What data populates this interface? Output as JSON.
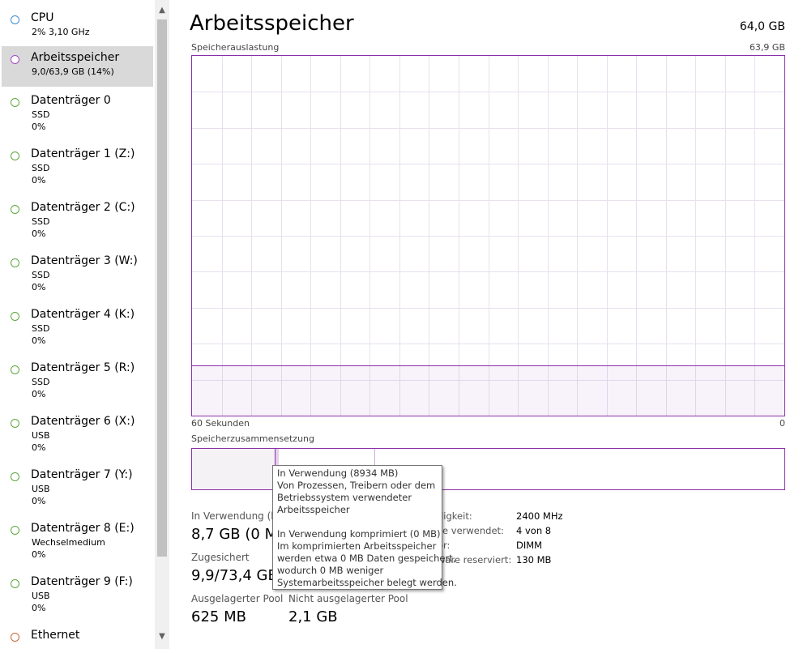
{
  "sidebar": {
    "items": [
      {
        "title": "CPU",
        "sub1": "2% 3,10 GHz",
        "sub2": "",
        "color": "#3c8fd7",
        "selected": false
      },
      {
        "title": "Arbeitsspeicher",
        "sub1": "9,0/63,9 GB (14%)",
        "sub2": "",
        "color": "#a64ac9",
        "selected": true
      },
      {
        "title": "Datenträger 0",
        "sub1": "SSD",
        "sub2": "0%",
        "color": "#5aa83c",
        "selected": false
      },
      {
        "title": "Datenträger 1 (Z:)",
        "sub1": "SSD",
        "sub2": "0%",
        "color": "#5aa83c",
        "selected": false
      },
      {
        "title": "Datenträger 2 (C:)",
        "sub1": "SSD",
        "sub2": "0%",
        "color": "#5aa83c",
        "selected": false
      },
      {
        "title": "Datenträger 3 (W:)",
        "sub1": "SSD",
        "sub2": "0%",
        "color": "#5aa83c",
        "selected": false
      },
      {
        "title": "Datenträger 4 (K:)",
        "sub1": "SSD",
        "sub2": "0%",
        "color": "#5aa83c",
        "selected": false
      },
      {
        "title": "Datenträger 5 (R:)",
        "sub1": "SSD",
        "sub2": "0%",
        "color": "#5aa83c",
        "selected": false
      },
      {
        "title": "Datenträger 6 (X:)",
        "sub1": "USB",
        "sub2": "0%",
        "color": "#5aa83c",
        "selected": false
      },
      {
        "title": "Datenträger 7 (Y:)",
        "sub1": "USB",
        "sub2": "0%",
        "color": "#5aa83c",
        "selected": false
      },
      {
        "title": "Datenträger 8 (E:)",
        "sub1": "Wechselmedium",
        "sub2": "0%",
        "color": "#5aa83c",
        "selected": false
      },
      {
        "title": "Datenträger 9 (F:)",
        "sub1": "USB",
        "sub2": "0%",
        "color": "#5aa83c",
        "selected": false
      },
      {
        "title": "Ethernet",
        "sub1": "",
        "sub2": "",
        "color": "#c56a35",
        "selected": false
      }
    ],
    "scroll_up_icon": "chevron-up-icon",
    "scroll_down_icon": "chevron-down-icon"
  },
  "main": {
    "title": "Arbeitsspeicher",
    "total": "64,0 GB",
    "usage_graph": {
      "label": "Speicherauslastung",
      "max_label": "63,9 GB",
      "x_left_label": "60 Sekunden",
      "x_right_label": "0",
      "used_fraction": 0.14
    },
    "composition": {
      "label": "Speicherzusammensetzung"
    },
    "stats": {
      "in_use_label": "In Verwendung (ko",
      "in_use_value": "8,7 GB (0 M",
      "committed_label": "Zugesichert",
      "committed_value": "9,9/73,4 GB",
      "paged_label": "Ausgelagerter Pool",
      "paged_value": "625 MB",
      "nonpaged_label": "Nicht ausgelagerter Pool",
      "nonpaged_value": "2,1 GB"
    },
    "details": [
      {
        "label": "digkeit:",
        "value": "2400 MHz"
      },
      {
        "label": "ze verwendet:",
        "value": "4 von 8"
      },
      {
        "label": "or:",
        "value": "DIMM"
      },
      {
        "label": "ware reserviert:",
        "value": "130 MB"
      }
    ]
  },
  "tooltip": {
    "lines": [
      "In Verwendung (8934 MB)",
      "Von Prozessen, Treibern oder dem",
      "Betriebssystem verwendeter",
      "Arbeitsspeicher",
      "",
      "In Verwendung komprimiert (0 MB)",
      "Im komprimierten Arbeitsspeicher",
      "werden etwa 0 MB Daten gespeichert,",
      "wodurch 0 MB weniger",
      "Systemarbeitsspeicher belegt werden."
    ]
  },
  "colors": {
    "memory_accent": "#8b2fa8",
    "memory_fill": "#f4f2f4",
    "grid": "#e8e0ee"
  }
}
